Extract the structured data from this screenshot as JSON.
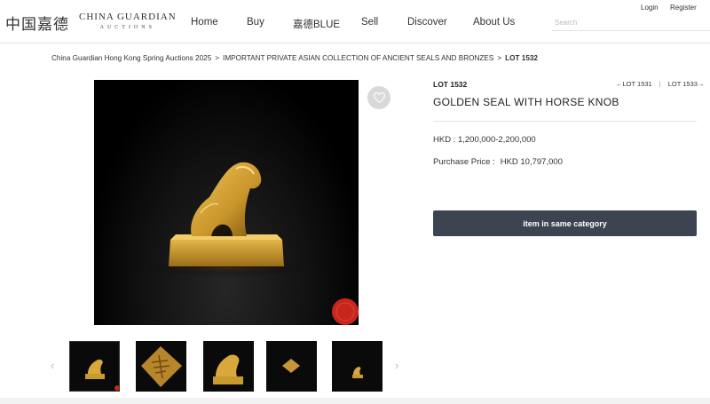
{
  "header": {
    "logo_cn": "中国嘉德",
    "logo_en": "CHINA GUARDIAN",
    "logo_en_sub": "AUCTIONS",
    "nav": [
      "Home",
      "Buy",
      "嘉德BLUE",
      "Sell",
      "Discover",
      "About Us"
    ],
    "login": "Login",
    "register": "Register",
    "search_placeholder": "Search"
  },
  "breadcrumb": {
    "items": [
      "China Guardian Hong Kong Spring Auctions 2025",
      "IMPORTANT PRIVATE ASIAN COLLECTION OF ANCIENT SEALS AND BRONZES",
      "LOT 1532"
    ],
    "separator": ">"
  },
  "lot": {
    "label": "LOT 1532",
    "prev": "LOT 1531",
    "next": "LOT 1533",
    "nav_divider": "|",
    "title": "GOLDEN SEAL WITH HORSE KNOB",
    "estimate": "HKD : 1,200,000-2,200,000",
    "purchase_label": "Purchase Price :",
    "purchase_value": "HKD 10,797,000",
    "category_button": "item in same category"
  },
  "icons": {
    "favorite": "heart-icon",
    "prev_arrow": "arrow-left-icon",
    "next_arrow": "arrow-right-icon",
    "carousel_prev": "chevron-left-icon",
    "carousel_next": "chevron-right-icon"
  },
  "colors": {
    "button_bg": "#3d4451",
    "gold": "#c99a2e",
    "seal_red": "#c8261c"
  }
}
